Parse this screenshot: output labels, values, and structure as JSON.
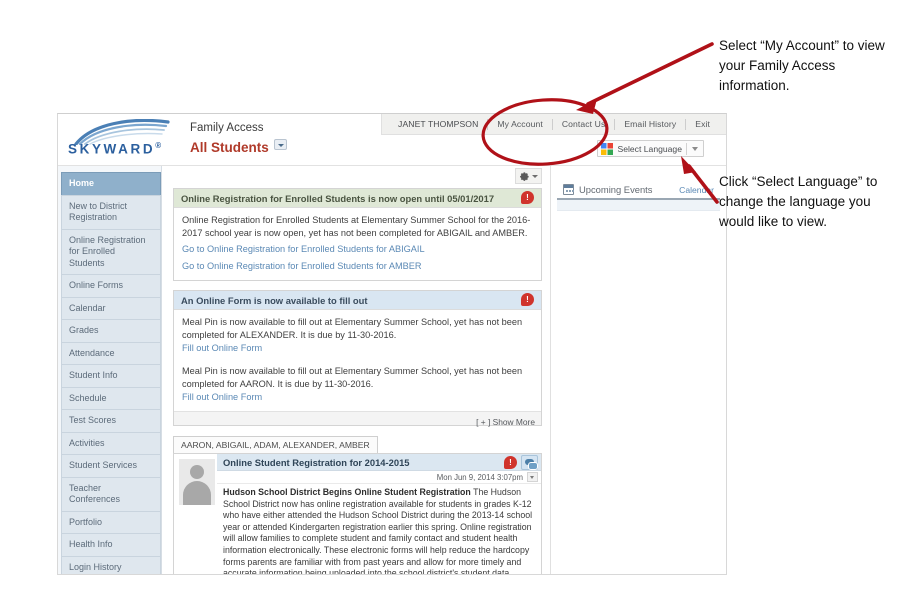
{
  "app": {
    "brand": {
      "wordmark": "SKYWARD",
      "trademark": "®",
      "product_title": "Family Access",
      "student_selector": "All Students"
    },
    "topnav": {
      "user": "JANET THOMPSON",
      "items": [
        {
          "label": "My Account"
        },
        {
          "label": "Contact Us"
        },
        {
          "label": "Email History"
        },
        {
          "label": "Exit"
        }
      ]
    },
    "translate": {
      "label": "Select Language",
      "icon": "google-translate-icon"
    },
    "toolbar": {
      "gear_icon": "gear-icon"
    },
    "sidebar": {
      "items": [
        {
          "label": "Home",
          "active": true
        },
        {
          "label": "New to District Registration",
          "active": false
        },
        {
          "label": "Online Registration for Enrolled Students",
          "active": false
        },
        {
          "label": "Online Forms",
          "active": false
        },
        {
          "label": "Calendar",
          "active": false
        },
        {
          "label": "Grades",
          "active": false
        },
        {
          "label": "Attendance",
          "active": false
        },
        {
          "label": "Student Info",
          "active": false
        },
        {
          "label": "Schedule",
          "active": false
        },
        {
          "label": "Test Scores",
          "active": false
        },
        {
          "label": "Activities",
          "active": false
        },
        {
          "label": "Student Services",
          "active": false
        },
        {
          "label": "Teacher Conferences",
          "active": false
        },
        {
          "label": "Portfolio",
          "active": false
        },
        {
          "label": "Health Info",
          "active": false
        },
        {
          "label": "Login History",
          "active": false
        }
      ]
    },
    "messages": [
      {
        "header": "Online Registration for Enrolled Students is now open until 05/01/2017",
        "header_style": "green",
        "badge": "!",
        "body": "Online Registration for Enrolled Students at Elementary Summer School for the 2016-2017 school year is now open, yet has not been completed for ABIGAIL and AMBER.",
        "links": [
          "Go to Online Registration for Enrolled Students for ABIGAIL",
          "Go to Online Registration for Enrolled Students for AMBER"
        ]
      },
      {
        "header": "An Online Form is now available to fill out",
        "header_style": "blue",
        "badge": "!",
        "body1": "Meal Pin is now available to fill out at Elementary Summer School, yet has not been completed for ALEXANDER.  It is due by 11-30-2016.",
        "link1": "Fill out Online Form",
        "body2": "Meal Pin is now available to fill out at Elementary Summer School, yet has not been completed for AARON.  It is due by 11-30-2016.",
        "link2": "Fill out Online Form",
        "footer": "[ + ] Show More"
      }
    ],
    "student_tab": "AARON, ABIGAIL, ADAM, ALEXANDER, AMBER",
    "article": {
      "title": "Online Student Registration for 2014-2015",
      "badge": "!",
      "date": "Mon Jun 9, 2014 3:07pm",
      "headline": "Hudson School District Begins Online Student Registration",
      "body": " The Hudson School District now has online registration available for students in grades K-12 who have either attended the Hudson School District during the 2013-14 school year or attended Kindergarten registration earlier this spring. Online registration will allow families to complete student and family contact and student health information electronically.  These electronic forms will help reduce the hardcopy forms parents are familiar with from past years and allow for more timely and accurate information being uploaded into the school district's student data information system.   Please click on the website below for further information.",
      "avatar_icon": "user-avatar-icon",
      "comment_icon": "comment-bubble-icon"
    },
    "right_panel": {
      "title": "Upcoming Events",
      "calendar_link": "Calendar",
      "icon": "calendar-icon"
    }
  },
  "annotations": [
    {
      "id": "ann1",
      "text": "Select “My Account” to view your Family Access information."
    },
    {
      "id": "ann2",
      "text": "Click “Select Language” to change the language you would like to view."
    }
  ],
  "annotation_color": "#b01118"
}
